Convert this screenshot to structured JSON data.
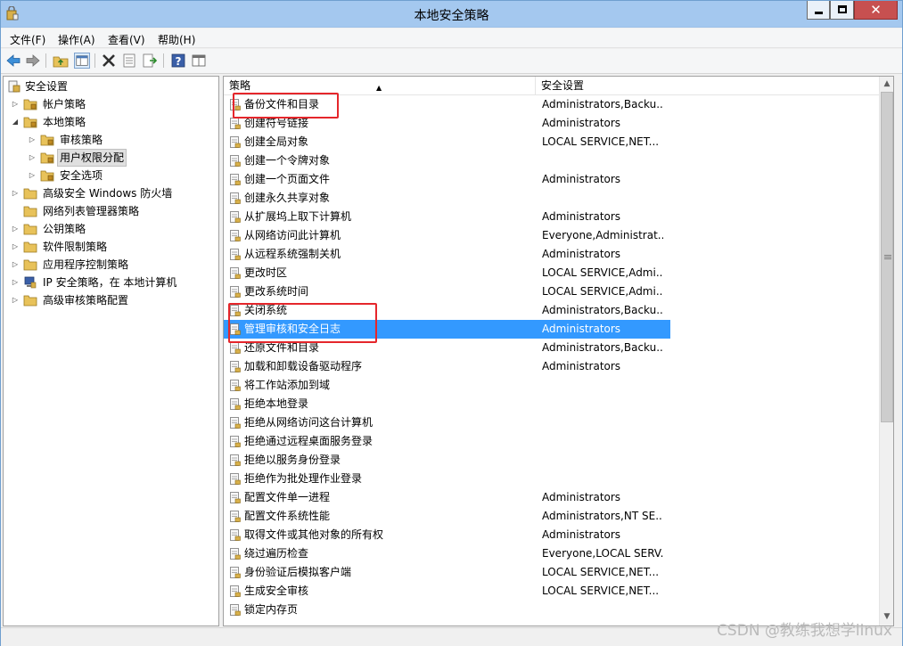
{
  "window": {
    "title": "本地安全策略",
    "close_glyph": "✕"
  },
  "menu": {
    "items": [
      "文件(F)",
      "操作(A)",
      "查看(V)",
      "帮助(H)"
    ]
  },
  "toolbar": {
    "icons": [
      "back-arrow-icon",
      "forward-arrow-icon",
      "up-folder-icon",
      "show-hide-tree-icon",
      "delete-icon",
      "properties-icon",
      "export-list-icon",
      "help-icon",
      "mmc-view-icon"
    ]
  },
  "tree": {
    "items": [
      {
        "label": "安全设置",
        "expanded": true
      },
      {
        "label": "帐户策略",
        "expanded": false
      },
      {
        "label": "本地策略",
        "expanded": true
      },
      {
        "label": "审核策略",
        "expanded": false
      },
      {
        "label": "用户权限分配",
        "expanded": false,
        "selected": true
      },
      {
        "label": "安全选项",
        "expanded": false
      },
      {
        "label": "高级安全 Windows 防火墙",
        "expanded": false
      },
      {
        "label": "网络列表管理器策略"
      },
      {
        "label": "公钥策略",
        "expanded": false
      },
      {
        "label": "软件限制策略",
        "expanded": false
      },
      {
        "label": "应用程序控制策略",
        "expanded": false
      },
      {
        "label": "IP 安全策略，在 本地计算机",
        "expanded": false
      },
      {
        "label": "高级审核策略配置",
        "expanded": false
      }
    ]
  },
  "list": {
    "columns": [
      "策略",
      "安全设置"
    ],
    "sort_indicator": "▲",
    "rows": [
      {
        "name": "备份文件和目录",
        "setting": "Administrators,Backu..."
      },
      {
        "name": "创建符号链接",
        "setting": "Administrators"
      },
      {
        "name": "创建全局对象",
        "setting": "LOCAL SERVICE,NET..."
      },
      {
        "name": "创建一个令牌对象",
        "setting": ""
      },
      {
        "name": "创建一个页面文件",
        "setting": "Administrators"
      },
      {
        "name": "创建永久共享对象",
        "setting": ""
      },
      {
        "name": "从扩展坞上取下计算机",
        "setting": "Administrators"
      },
      {
        "name": "从网络访问此计算机",
        "setting": "Everyone,Administrat..."
      },
      {
        "name": "从远程系统强制关机",
        "setting": "Administrators"
      },
      {
        "name": "更改时区",
        "setting": "LOCAL SERVICE,Admi..."
      },
      {
        "name": "更改系统时间",
        "setting": "LOCAL SERVICE,Admi..."
      },
      {
        "name": "关闭系统",
        "setting": "Administrators,Backu..."
      },
      {
        "name": "管理审核和安全日志",
        "setting": "Administrators",
        "selected": true
      },
      {
        "name": "还原文件和目录",
        "setting": "Administrators,Backu..."
      },
      {
        "name": "加载和卸载设备驱动程序",
        "setting": "Administrators"
      },
      {
        "name": "将工作站添加到域",
        "setting": ""
      },
      {
        "name": "拒绝本地登录",
        "setting": ""
      },
      {
        "name": "拒绝从网络访问这台计算机",
        "setting": ""
      },
      {
        "name": "拒绝通过远程桌面服务登录",
        "setting": ""
      },
      {
        "name": "拒绝以服务身份登录",
        "setting": ""
      },
      {
        "name": "拒绝作为批处理作业登录",
        "setting": ""
      },
      {
        "name": "配置文件单一进程",
        "setting": "Administrators"
      },
      {
        "name": "配置文件系统性能",
        "setting": "Administrators,NT SE..."
      },
      {
        "name": "取得文件或其他对象的所有权",
        "setting": "Administrators"
      },
      {
        "name": "绕过遍历检查",
        "setting": "Everyone,LOCAL SERV..."
      },
      {
        "name": "身份验证后模拟客户端",
        "setting": "LOCAL SERVICE,NET..."
      },
      {
        "name": "生成安全审核",
        "setting": "LOCAL SERVICE,NET..."
      },
      {
        "name": "锁定内存页",
        "setting": ""
      }
    ]
  },
  "scrollbar": {
    "up_glyph": "▲",
    "down_glyph": "▼"
  },
  "watermark": "CSDN @教练我想学linux",
  "colors": {
    "titlebar": "#a4c8ef",
    "selection": "#3399ff",
    "annotation": "#e5262b",
    "close_button": "#c75050"
  }
}
